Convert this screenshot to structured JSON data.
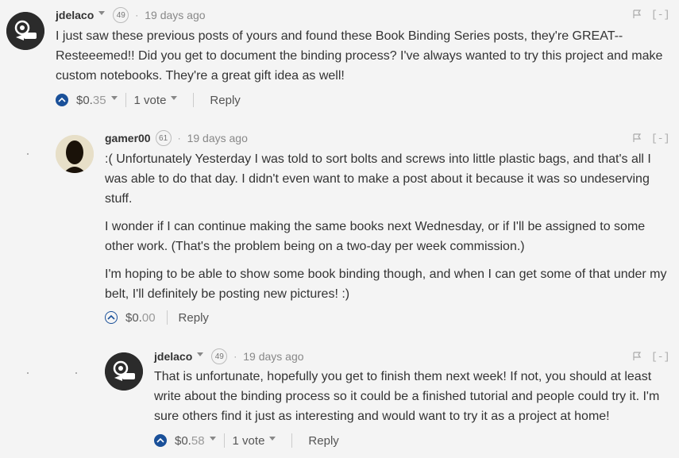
{
  "comments": [
    {
      "author": "jdelaco",
      "reputation": "49",
      "separator": "·",
      "time": "19 days ago",
      "paragraphs": [
        "I just saw these previous posts of yours and found these Book Binding Series posts, they're GREAT--Resteeemed!! Did you get to document the binding process? I've always wanted to try this project and make custom notebooks. They're a great gift idea as well!"
      ],
      "payout_dollars": "$0.",
      "payout_cents": "35",
      "votes": "1 vote",
      "reply": "Reply",
      "collapse": "[-]"
    },
    {
      "author": "gamer00",
      "reputation": "61",
      "separator": "·",
      "time": "19 days ago",
      "paragraphs": [
        ":( Unfortunately Yesterday I was told to sort bolts and screws into little plastic bags, and that's all I was able to do that day. I didn't even want to make a post about it because it was so undeserving stuff.",
        "I wonder if I can continue making the same books next Wednesday, or if I'll be assigned to some other work. (That's the problem being on a two-day per week commission.)",
        "I'm hoping to be able to show some book binding though, and when I can get some of that under my belt, I'll definitely be posting new pictures! :)"
      ],
      "payout_dollars": "$0.",
      "payout_cents": "00",
      "reply": "Reply",
      "collapse": "[-]"
    },
    {
      "author": "jdelaco",
      "reputation": "49",
      "separator": "·",
      "time": "19 days ago",
      "paragraphs": [
        "That is unfortunate, hopefully you get to finish them next week! If not, you should at least write about the binding process so it could be a finished tutorial and people could try it. I'm sure others find it just as interesting and would want to try it as a project at home!"
      ],
      "payout_dollars": "$0.",
      "payout_cents": "58",
      "votes": "1 vote",
      "reply": "Reply",
      "collapse": "[-]"
    }
  ],
  "colors": {
    "accent": "#1a5099",
    "background": "#f4f4f4",
    "text": "#333333"
  },
  "icons": [
    "flag-icon",
    "upvote-icon",
    "chevron-down-icon",
    "avatar-logo",
    "avatar-photo"
  ]
}
